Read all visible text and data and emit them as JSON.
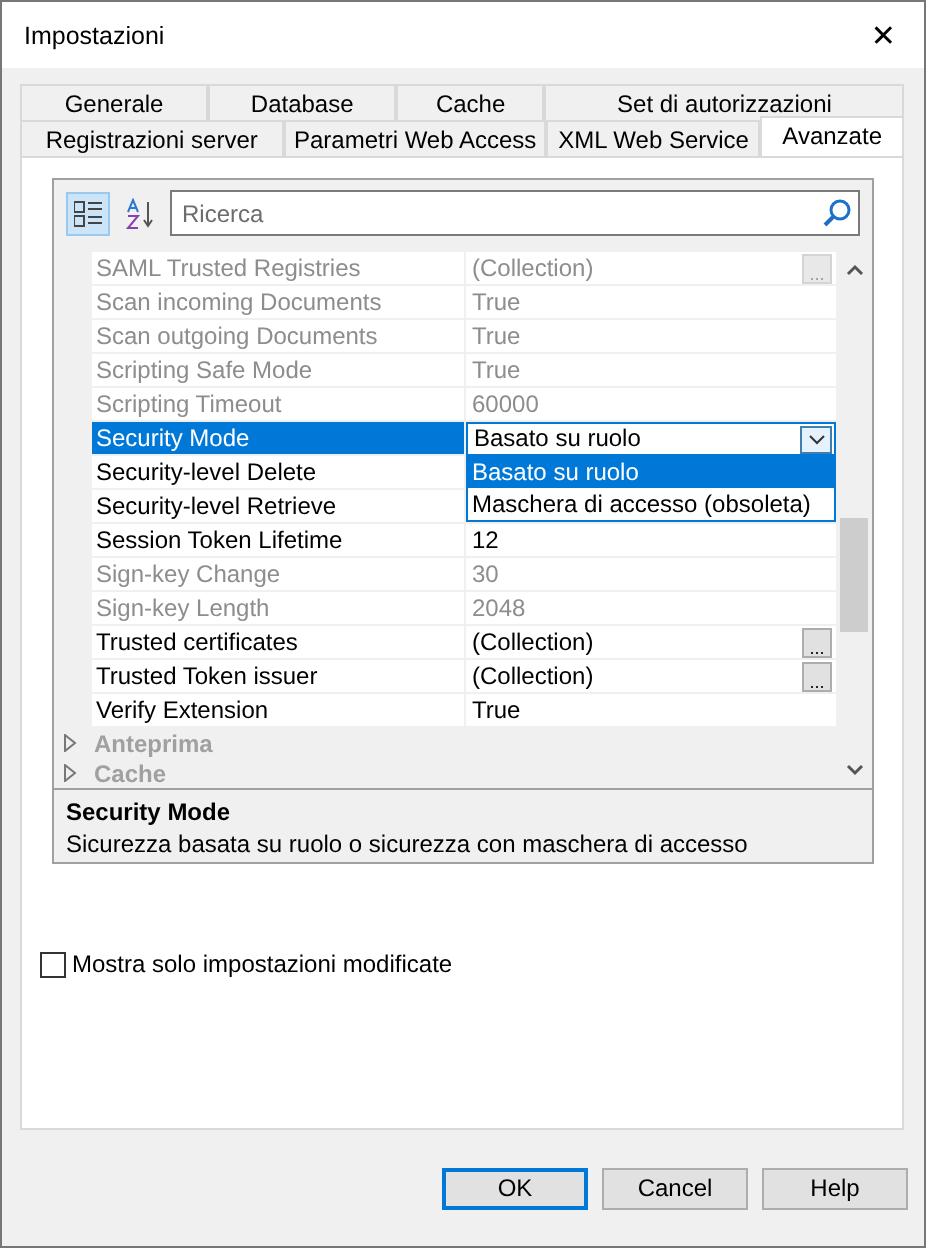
{
  "window": {
    "title": "Impostazioni",
    "close": "✕"
  },
  "tab_rows": [
    [
      {
        "label": "Generale",
        "selected": false
      },
      {
        "label": "Database",
        "selected": false
      },
      {
        "label": "Cache",
        "selected": false
      },
      {
        "label": "Set di autorizzazioni",
        "selected": false
      }
    ],
    [
      {
        "label": "Registrazioni server",
        "selected": false
      },
      {
        "label": "Parametri Web Access",
        "selected": false
      },
      {
        "label": "XML Web Service",
        "selected": false
      },
      {
        "label": "Avanzate",
        "selected": true
      }
    ]
  ],
  "toolbar": {
    "categorized_selected": true,
    "search": {
      "placeholder": "Ricerca"
    }
  },
  "rows": [
    {
      "name": "SAML Trusted Registries",
      "value": "(Collection)",
      "disabled": true,
      "selected": false,
      "kind": "ellipsis",
      "button": "..."
    },
    {
      "name": "Scan incoming Documents",
      "value": "True",
      "disabled": true,
      "selected": false
    },
    {
      "name": "Scan outgoing Documents",
      "value": "True",
      "disabled": true,
      "selected": false
    },
    {
      "name": "Scripting Safe Mode",
      "value": "True",
      "disabled": true,
      "selected": false
    },
    {
      "name": "Scripting Timeout",
      "value": "60000",
      "disabled": true,
      "selected": false
    },
    {
      "name": "Security Mode",
      "value": "Basato su ruolo",
      "disabled": false,
      "selected": true,
      "kind": "dropdown",
      "options": [
        {
          "label": "Basato su ruolo",
          "selected": true
        },
        {
          "label": "Maschera di accesso (obsoleta)",
          "selected": false
        }
      ]
    },
    {
      "name": "Security-level Delete",
      "disabled": false,
      "selected": false
    },
    {
      "name": "Security-level Retrieve",
      "disabled": false,
      "selected": false
    },
    {
      "name": "Session Token Lifetime",
      "value": "12",
      "disabled": false,
      "selected": false
    },
    {
      "name": "Sign-key Change",
      "value": "30",
      "disabled": true,
      "selected": false
    },
    {
      "name": "Sign-key Length",
      "value": "2048",
      "disabled": true,
      "selected": false
    },
    {
      "name": "Trusted certificates",
      "value": "(Collection)",
      "disabled": false,
      "selected": false,
      "kind": "ellipsis",
      "button": "..."
    },
    {
      "name": "Trusted Token issuer",
      "value": "(Collection)",
      "disabled": false,
      "selected": false,
      "kind": "ellipsis",
      "button": "..."
    },
    {
      "name": "Verify Extension",
      "value": "True",
      "disabled": false,
      "selected": false
    }
  ],
  "categories": [
    {
      "label": "Anteprima",
      "expanded": false
    },
    {
      "label": "Cache",
      "expanded": false
    }
  ],
  "description": {
    "title": "Security Mode",
    "text": "Sicurezza basata su ruolo o sicurezza con maschera di accesso"
  },
  "checkbox": {
    "label": "Mostra solo impostazioni modificate",
    "checked": false
  },
  "buttons": [
    {
      "label": "OK",
      "default": true
    },
    {
      "label": "Cancel",
      "default": false
    },
    {
      "label": "Help",
      "default": false
    }
  ]
}
